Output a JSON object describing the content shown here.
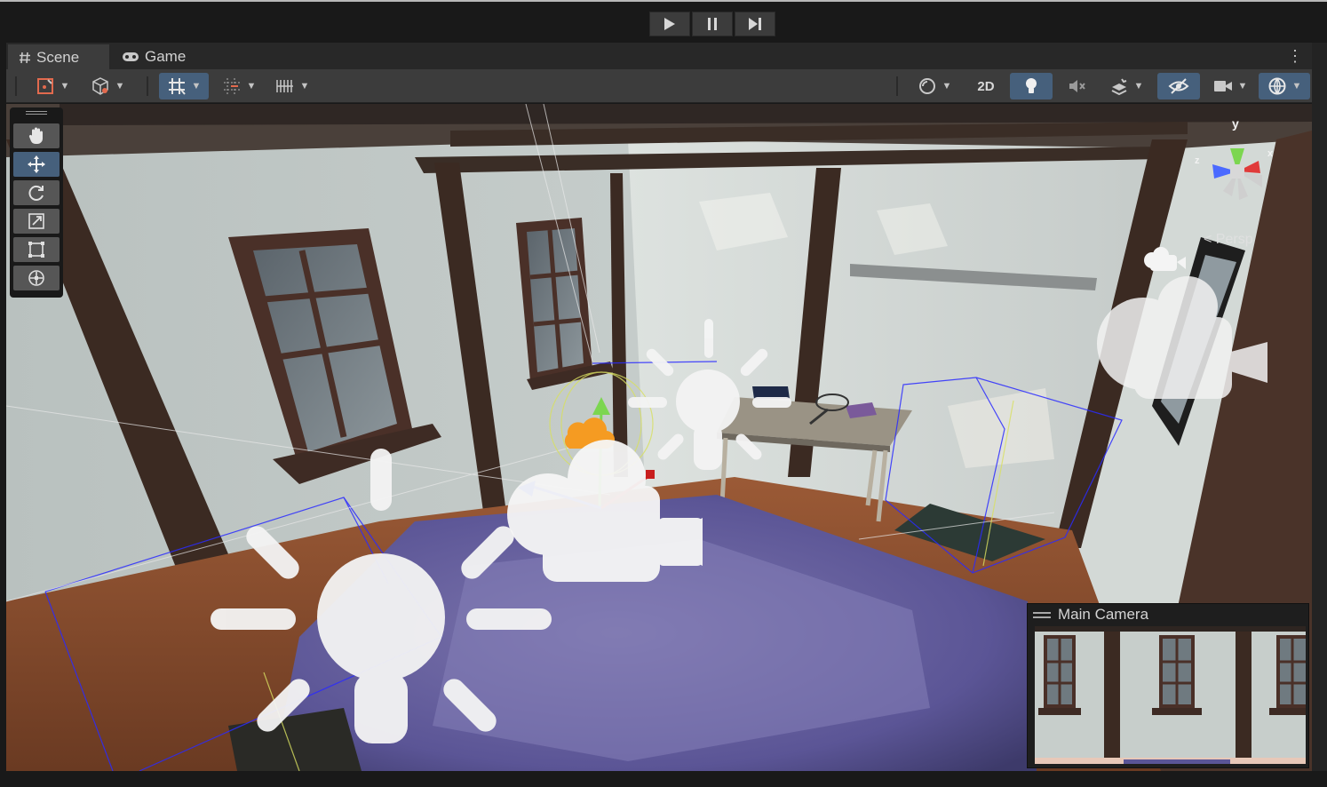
{
  "playbar": {
    "play_icon": "play-icon",
    "pause_icon": "pause-icon",
    "step_icon": "step-icon"
  },
  "tabs": [
    {
      "label": "Scene",
      "icon": "hash-icon",
      "active": true
    },
    {
      "label": "Game",
      "icon": "gamepad-icon",
      "active": false
    }
  ],
  "toolbar": {
    "mode_2d_label": "2D",
    "accent_color": "#46607c"
  },
  "viewport": {
    "persp_label": "< Persp",
    "gizmo_axes": {
      "y": "y",
      "x": "x",
      "z": "z"
    }
  },
  "camera_preview": {
    "title": "Main Camera"
  }
}
